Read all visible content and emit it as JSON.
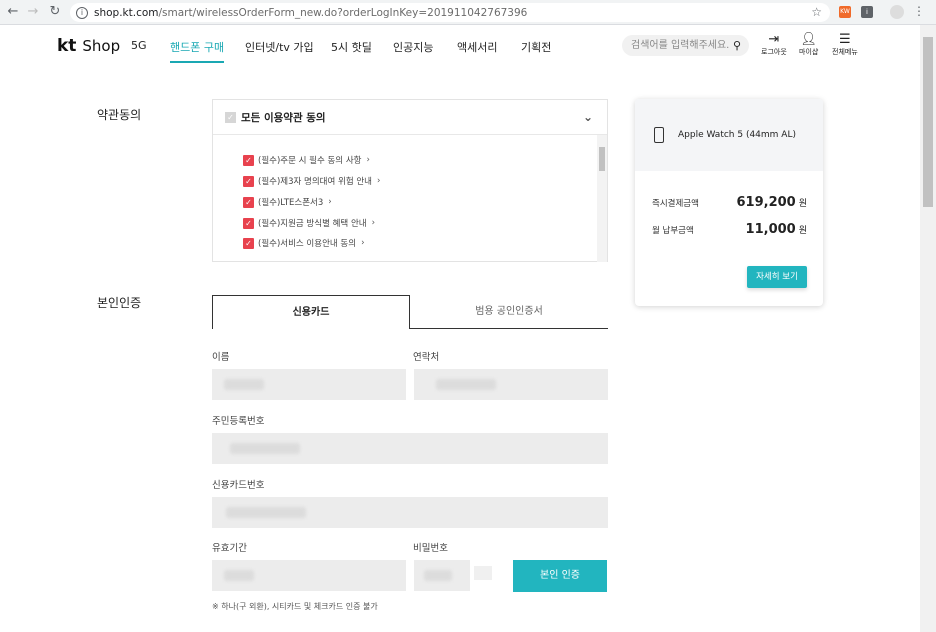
{
  "browser": {
    "url_host": "shop.kt.com",
    "url_path": "/smart/wirelessOrderForm_new.do?orderLogInKey=201911042767396",
    "ext1_label": "KW",
    "ext2_label": "i"
  },
  "header": {
    "logo_kt": "kt",
    "logo_shop": "Shop",
    "nav": [
      "5G",
      "핸드폰 구매",
      "인터넷/tv 가입",
      "5시 핫딜",
      "인공지능",
      "액세서리",
      "기획전"
    ],
    "search_placeholder": "검색어를 입력해주세요.",
    "util": {
      "logout": "로그아웃",
      "mypage": "마이샵",
      "menu": "전체메뉴"
    }
  },
  "terms": {
    "section_title": "약관동의",
    "all_label": "모든 이용약관 동의",
    "items": [
      "(필수)주문 시 필수 동의 사항",
      "(필수)제3자 명의대여 위험 안내",
      "(필수)LTE스폰서3",
      "(필수)지원금 방식별 혜택 안내",
      "(필수)서비스 이용안내 동의"
    ]
  },
  "identity": {
    "section_title": "본인인증",
    "tab_card": "신용카드",
    "tab_cert": "범용 공인인증서",
    "label_name": "이름",
    "label_phone": "연락처",
    "label_rrn": "주민등록번호",
    "label_card": "신용카드번호",
    "label_expiry": "유효기간",
    "label_password": "비밀번호",
    "verify_button": "본인 인증",
    "note": "※ 하나(구 외환), 시티카드 및 체크카드 인증 불가"
  },
  "summary": {
    "product": "Apple Watch 5 (44mm AL)",
    "pay_now_label": "즉시결제금액",
    "pay_now_value": "619,200",
    "monthly_label": "월 납부금액",
    "monthly_value": "11,000",
    "currency": "원",
    "detail_button": "자세히 보기"
  },
  "colors": {
    "accent": "#1aa8b3",
    "check": "#e8424e"
  }
}
